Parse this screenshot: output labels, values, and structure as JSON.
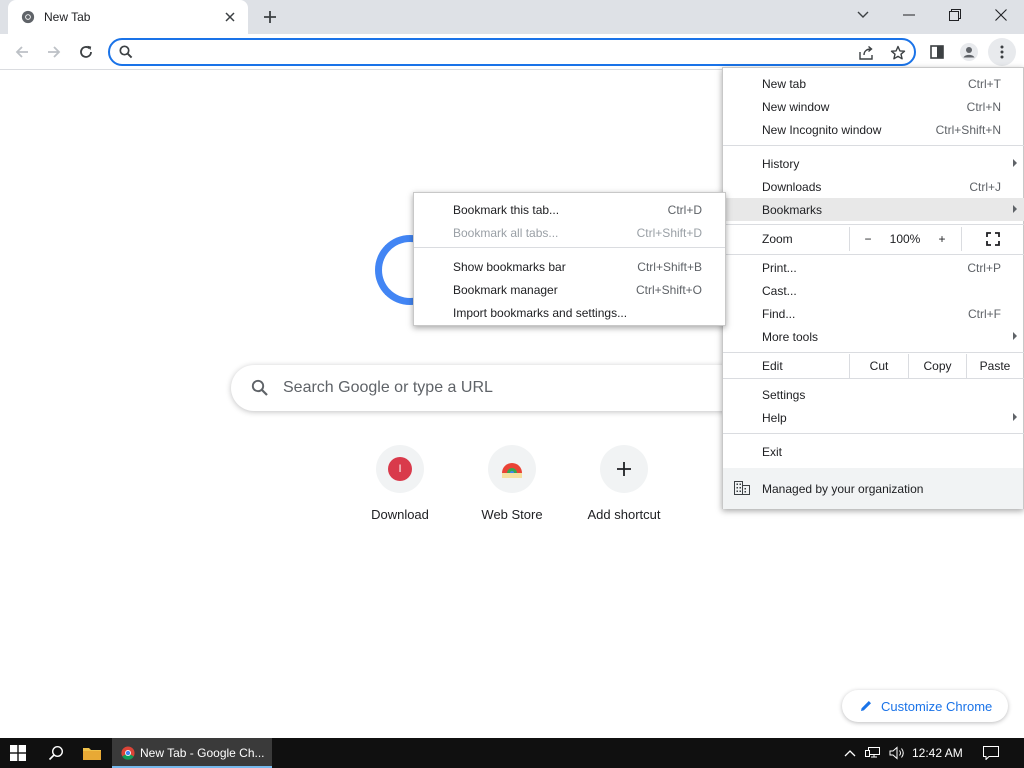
{
  "browser": {
    "tab": {
      "title": "New Tab"
    },
    "omnibox": {
      "value": ""
    }
  },
  "ntp": {
    "search_placeholder": "Search Google or type a URL",
    "shortcuts": [
      {
        "label": "Download",
        "icon": "download-site-icon",
        "letter": "I",
        "color": "#d93a4b"
      },
      {
        "label": "Web Store",
        "icon": "web-store-icon"
      },
      {
        "label": "Add shortcut",
        "icon": "plus-icon"
      }
    ],
    "customize_label": "Customize Chrome"
  },
  "menu": {
    "items": [
      {
        "label": "New tab",
        "shortcut": "Ctrl+T"
      },
      {
        "label": "New window",
        "shortcut": "Ctrl+N"
      },
      {
        "label": "New Incognito window",
        "shortcut": "Ctrl+Shift+N"
      },
      {
        "label": "History",
        "shortcut": ""
      },
      {
        "label": "Downloads",
        "shortcut": "Ctrl+J"
      },
      {
        "label": "Bookmarks",
        "shortcut": ""
      },
      {
        "label": "Print...",
        "shortcut": "Ctrl+P"
      },
      {
        "label": "Cast...",
        "shortcut": ""
      },
      {
        "label": "Find...",
        "shortcut": "Ctrl+F"
      },
      {
        "label": "More tools",
        "shortcut": ""
      },
      {
        "label": "Settings",
        "shortcut": ""
      },
      {
        "label": "Help",
        "shortcut": ""
      },
      {
        "label": "Exit",
        "shortcut": ""
      }
    ],
    "zoom": {
      "label": "Zoom",
      "minus": "−",
      "value": "100%",
      "plus": "+"
    },
    "edit": {
      "label": "Edit",
      "cut": "Cut",
      "copy": "Copy",
      "paste": "Paste"
    },
    "managed_label": "Managed by your organization"
  },
  "bookmarks_submenu": {
    "items": [
      {
        "label": "Bookmark this tab...",
        "shortcut": "Ctrl+D",
        "enabled": true
      },
      {
        "label": "Bookmark all tabs...",
        "shortcut": "Ctrl+Shift+D",
        "enabled": false
      },
      {
        "label": "Show bookmarks bar",
        "shortcut": "Ctrl+Shift+B",
        "enabled": true
      },
      {
        "label": "Bookmark manager",
        "shortcut": "Ctrl+Shift+O",
        "enabled": true
      },
      {
        "label": "Import bookmarks and settings...",
        "shortcut": "",
        "enabled": true
      }
    ]
  },
  "taskbar": {
    "app_label": "New Tab - Google Ch...",
    "clock": "12:42 AM"
  },
  "colors": {
    "accent": "#1a73e8",
    "tabstrip": "#dee1e6",
    "taskbar": "#101010"
  }
}
